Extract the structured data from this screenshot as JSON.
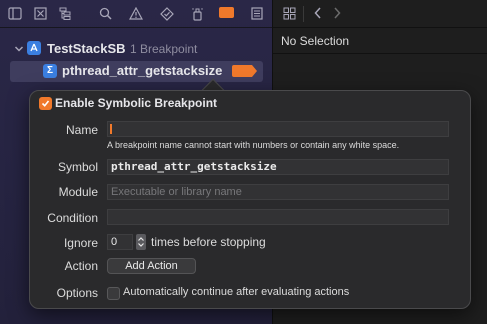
{
  "navigator": {
    "toolbar_icons": [
      "folder-icon",
      "xmark-square-icon",
      "hierarchy-icon",
      "search-icon",
      "warning-icon",
      "diamond-check-icon",
      "spray-icon",
      "breakpoint-icon",
      "list-icon"
    ],
    "project": {
      "name": "TestStackSB",
      "count": "1 Breakpoint"
    },
    "breakpoint": {
      "icon": "Σ",
      "name": "pthread_attr_getstacksize"
    }
  },
  "editor": {
    "jump_bar": "No Selection"
  },
  "popover": {
    "enable_label": "Enable Symbolic Breakpoint",
    "name": {
      "label": "Name",
      "value": "",
      "hint": "A breakpoint name cannot start with numbers or contain any white space."
    },
    "symbol": {
      "label": "Symbol",
      "value": "pthread_attr_getstacksize"
    },
    "module": {
      "label": "Module",
      "placeholder": "Executable or library name"
    },
    "condition": {
      "label": "Condition",
      "value": ""
    },
    "ignore": {
      "label": "Ignore",
      "value": "0",
      "suffix": "times before stopping"
    },
    "action": {
      "label": "Action",
      "button": "Add Action"
    },
    "options": {
      "label": "Options",
      "text": "Automatically continue after evaluating actions",
      "checked": false
    }
  },
  "colors": {
    "accent": "#f0792b",
    "navigator_bg": "#262442",
    "selection": "#3f3d5e",
    "popover_bg": "#2a2a2c"
  }
}
